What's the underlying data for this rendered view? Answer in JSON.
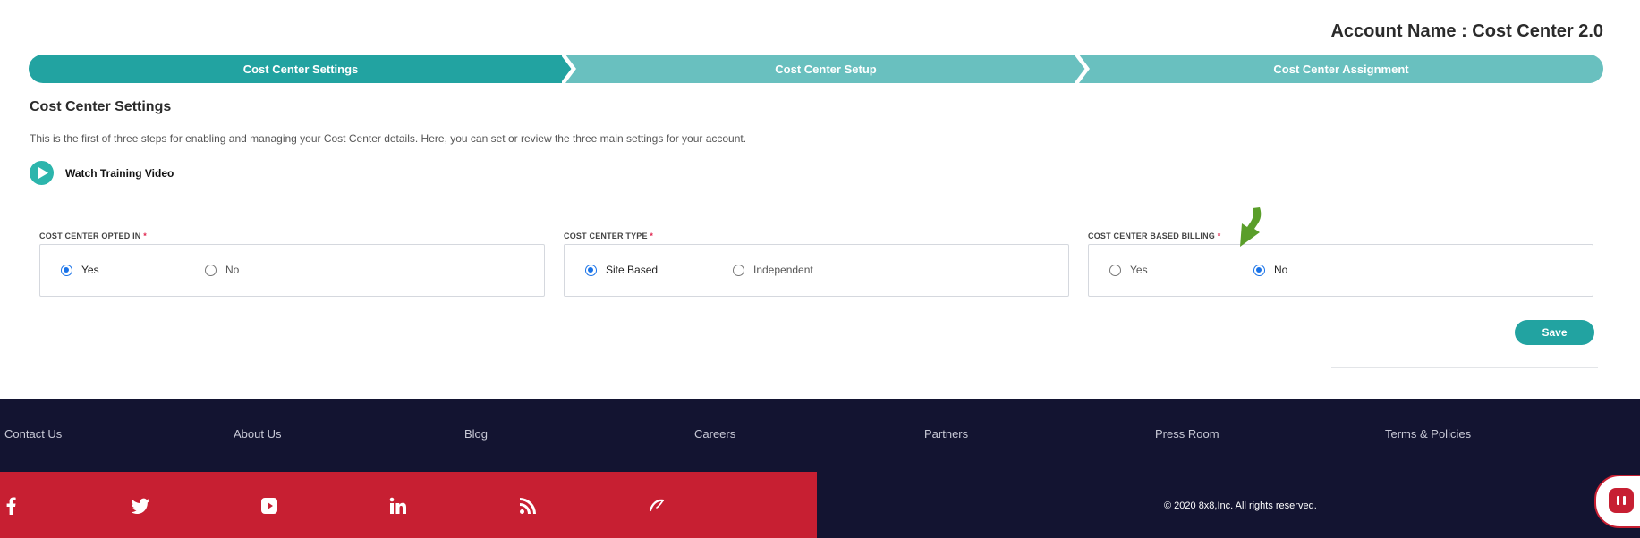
{
  "account": {
    "label": "Account Name : Cost Center 2.0"
  },
  "stepper": {
    "steps": [
      {
        "label": "Cost Center Settings",
        "active": true
      },
      {
        "label": "Cost Center Setup",
        "active": false
      },
      {
        "label": "Cost Center Assignment",
        "active": false
      }
    ]
  },
  "section": {
    "title": "Cost Center Settings",
    "description": "This is the first of three steps for enabling and managing your Cost Center details. Here, you can set or review the three main settings for your account.",
    "training_label": "Watch Training Video"
  },
  "fields": [
    {
      "label": "COST CENTER OPTED IN",
      "required": "*",
      "options": [
        "Yes",
        "No"
      ],
      "selected": "Yes"
    },
    {
      "label": "COST CENTER TYPE",
      "required": "*",
      "options": [
        "Site Based",
        "Independent"
      ],
      "selected": "Site Based"
    },
    {
      "label": "COST CENTER BASED BILLING",
      "required": "*",
      "options": [
        "Yes",
        "No"
      ],
      "selected": "No"
    }
  ],
  "actions": {
    "save_label": "Save"
  },
  "footer": {
    "links": [
      "Contact Us",
      "About Us",
      "Blog",
      "Careers",
      "Partners",
      "Press Room",
      "Terms & Policies"
    ],
    "social_icons": [
      "facebook-icon",
      "twitter-icon",
      "youtube-icon",
      "linkedin-icon",
      "rss-icon",
      "8x8-logo-icon"
    ],
    "copyright": "© 2020 8x8,Inc. All rights reserved."
  },
  "colors": {
    "primary": "#22a3a1",
    "step_inactive": "#69c0bf",
    "radio_checked": "#1a73e8",
    "footer_dark": "#131431",
    "footer_red": "#c71f32",
    "required": "#e0264f",
    "annotation_arrow": "#5a9e2a"
  }
}
